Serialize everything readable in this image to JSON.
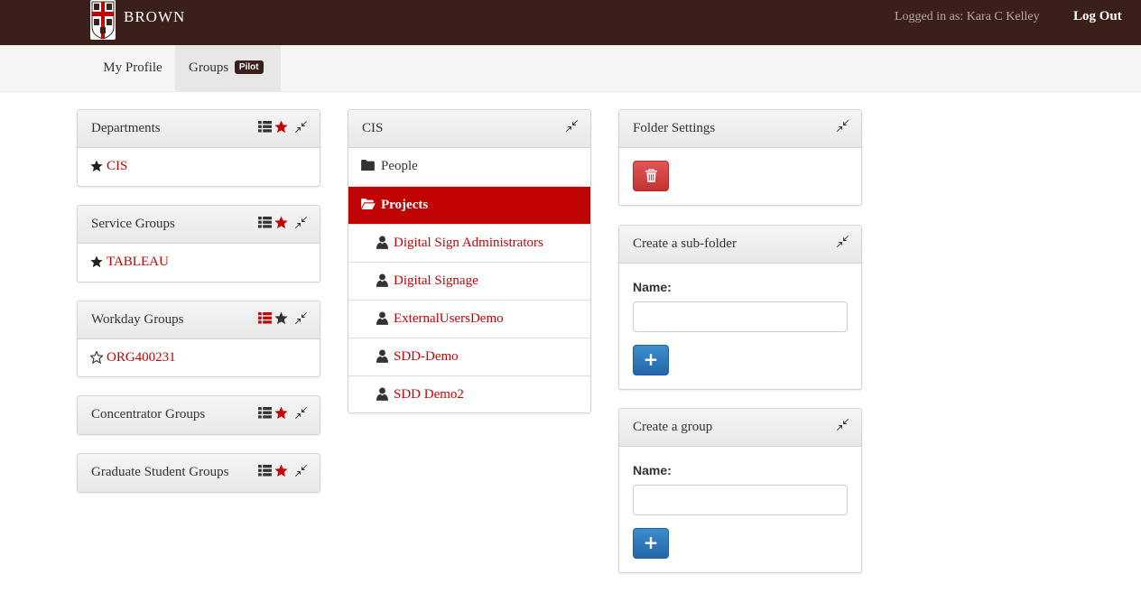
{
  "header": {
    "brand": "BROWN",
    "logged_in": "Logged in as: Kara C Kelley",
    "logout": "Log Out"
  },
  "nav": {
    "profile": "My Profile",
    "groups": "Groups",
    "badge": "Pilot"
  },
  "left_panels": [
    {
      "title": "Departments",
      "item": "CIS"
    },
    {
      "title": "Service Groups",
      "item": "TABLEAU"
    },
    {
      "title": "Workday Groups",
      "item": "ORG400231"
    },
    {
      "title": "Concentrator Groups"
    },
    {
      "title": "Graduate Student Groups"
    }
  ],
  "folder": {
    "title": "CIS",
    "items": [
      "People",
      "Projects"
    ],
    "users": [
      "Digital Sign Administrators",
      "Digital Signage",
      "ExternalUsersDemo",
      "SDD-Demo",
      "SDD Demo2"
    ]
  },
  "settings": {
    "title": "Folder Settings"
  },
  "subfolder": {
    "title": "Create a sub-folder",
    "name_label": "Name:"
  },
  "group": {
    "title": "Create a group",
    "name_label": "Name:"
  },
  "colors": {
    "topbar": "#3b1f1a",
    "accent_red": "#c00404",
    "primary_blue": "#2d74b9",
    "danger_red": "#d43f3a"
  },
  "icons": [
    "shield-logo",
    "list-icon",
    "star-icon",
    "star-empty-icon",
    "compress-icon",
    "folder-icon",
    "folder-open-icon",
    "user-icon",
    "trash-icon",
    "plus-icon"
  ]
}
